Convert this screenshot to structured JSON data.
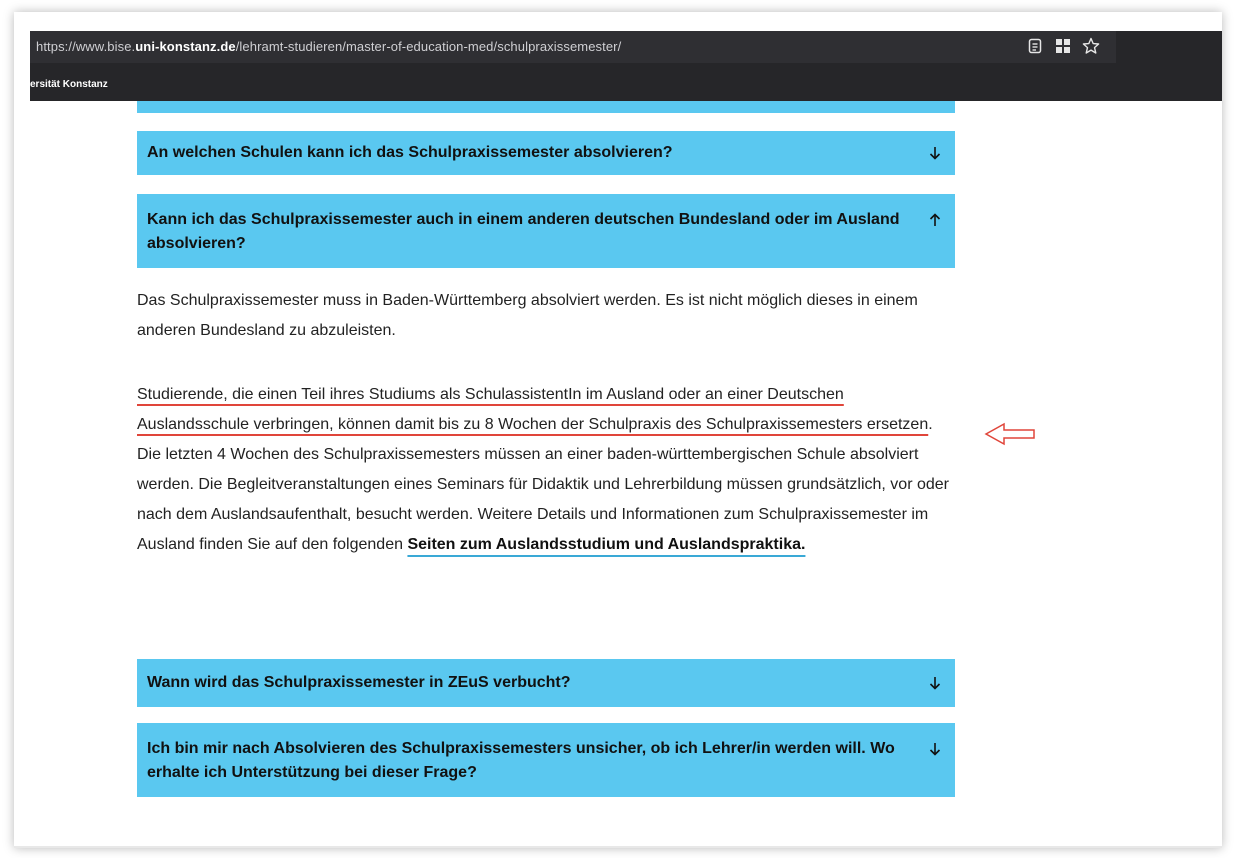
{
  "browser": {
    "url_prefix": "https://www.bise.",
    "url_domain": "uni-konstanz.de",
    "url_path": "/lehramt-studieren/master-of-education-med/schulpraxissemester/",
    "icons": [
      "reader-icon",
      "grid-icon",
      "star-icon"
    ],
    "site_label": "ersität Konstanz"
  },
  "faq": [
    {
      "question": "An welchen Schulen kann ich das Schulpraxissemester absolvieren?",
      "arrow": "↓",
      "expanded": false
    },
    {
      "question": "Kann ich das Schulpraxissemester auch in einem anderen deutschen Bundesland oder im Ausland absolvieren?",
      "arrow": "↑",
      "expanded": true
    },
    {
      "question": "Wann wird das Schulpraxissemester in ZEuS verbucht?",
      "arrow": "↓",
      "expanded": false
    },
    {
      "question": "Ich bin mir nach Absolvieren des Schulpraxissemesters unsicher, ob ich Lehrer/in werden will. Wo erhalte ich Unterstützung bei dieser Frage?",
      "arrow": "↓",
      "expanded": false
    }
  ],
  "answer": {
    "p1": "Das Schulpraxissemester muss in Baden-Württemberg absolviert werden. Es ist nicht möglich dieses in einem anderen Bundesland zu abzuleisten.",
    "p2_highlight": "Studierende, die einen Teil ihres Studiums als SchulassistentIn im Ausland oder an einer Deutschen Auslandsschule verbringen, können damit bis zu 8 Wochen der Schulpraxis des Schulpraxissemesters ersetzen",
    "p2_rest": ". Die letzten 4 Wochen des Schulpraxissemesters müssen an einer baden-württembergischen Schule absolviert werden. Die Begleitveranstaltungen eines Seminars für Didaktik und Lehrerbildung müssen grundsätzlich, vor oder nach dem Auslandsaufenthalt, besucht werden. Weitere Details und Informationen zum Schulpraxissemester im Ausland finden Sie auf den folgenden ",
    "p2_link": "Seiten zum Auslandsstudium und Auslandspraktika."
  },
  "colors": {
    "accent": "#5ac8f0",
    "annotation": "#e0453a",
    "link_underline": "#3aa9d6",
    "toolbar": "#262629"
  }
}
